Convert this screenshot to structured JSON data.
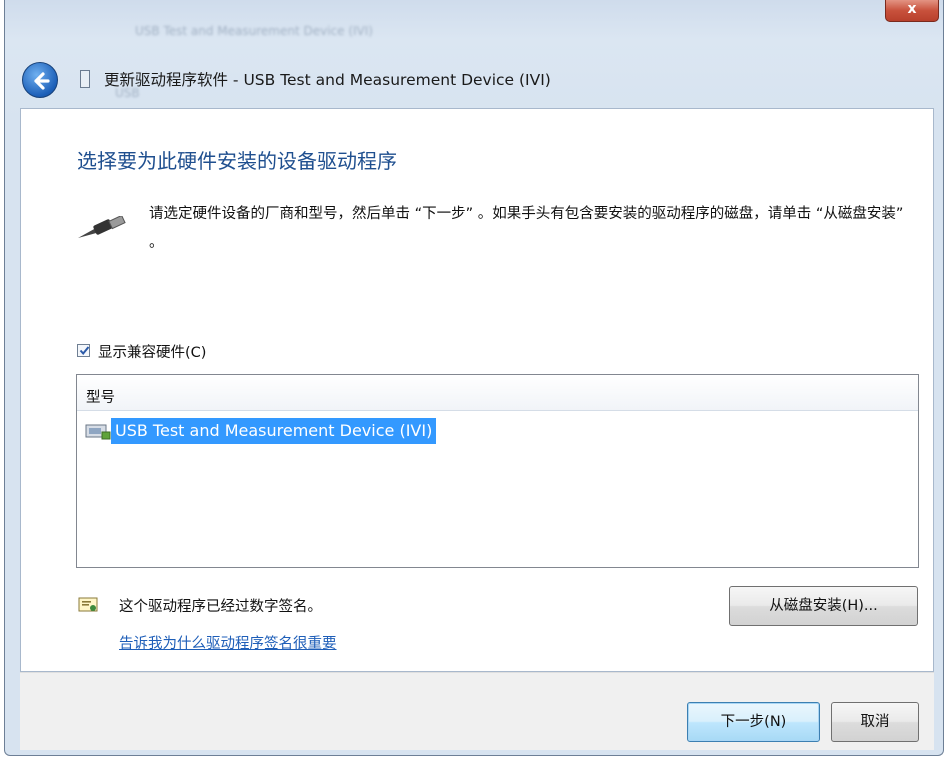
{
  "window": {
    "title": "更新驱动程序软件 - USB Test and Measurement Device (IVI)",
    "close_glyph": "x",
    "background_text_1": "USB Test and Measurement Device (IVI)",
    "background_text_2": "USB"
  },
  "main": {
    "heading": "选择要为此硬件安装的设备驱动程序",
    "instruction": "请选定硬件设备的厂商和型号，然后单击 “下一步” 。如果手头有包含要安装的驱动程序的磁盘，请单击 “从磁盘安装” 。",
    "show_compatible_label": "显示兼容硬件(C)",
    "show_compatible_checked": true
  },
  "model_list": {
    "header": "型号",
    "items": [
      "USB Test and Measurement Device (IVI)"
    ],
    "selected_index": 0
  },
  "signature": {
    "text": "这个驱动程序已经过数字签名。",
    "link": "告诉我为什么驱动程序签名很重要"
  },
  "buttons": {
    "have_disk": "从磁盘安装(H)...",
    "next": "下一步(N)",
    "cancel": "取消"
  },
  "colors": {
    "heading": "#1f4f8f",
    "selection": "#3399ff",
    "link": "#1e5eb8"
  }
}
